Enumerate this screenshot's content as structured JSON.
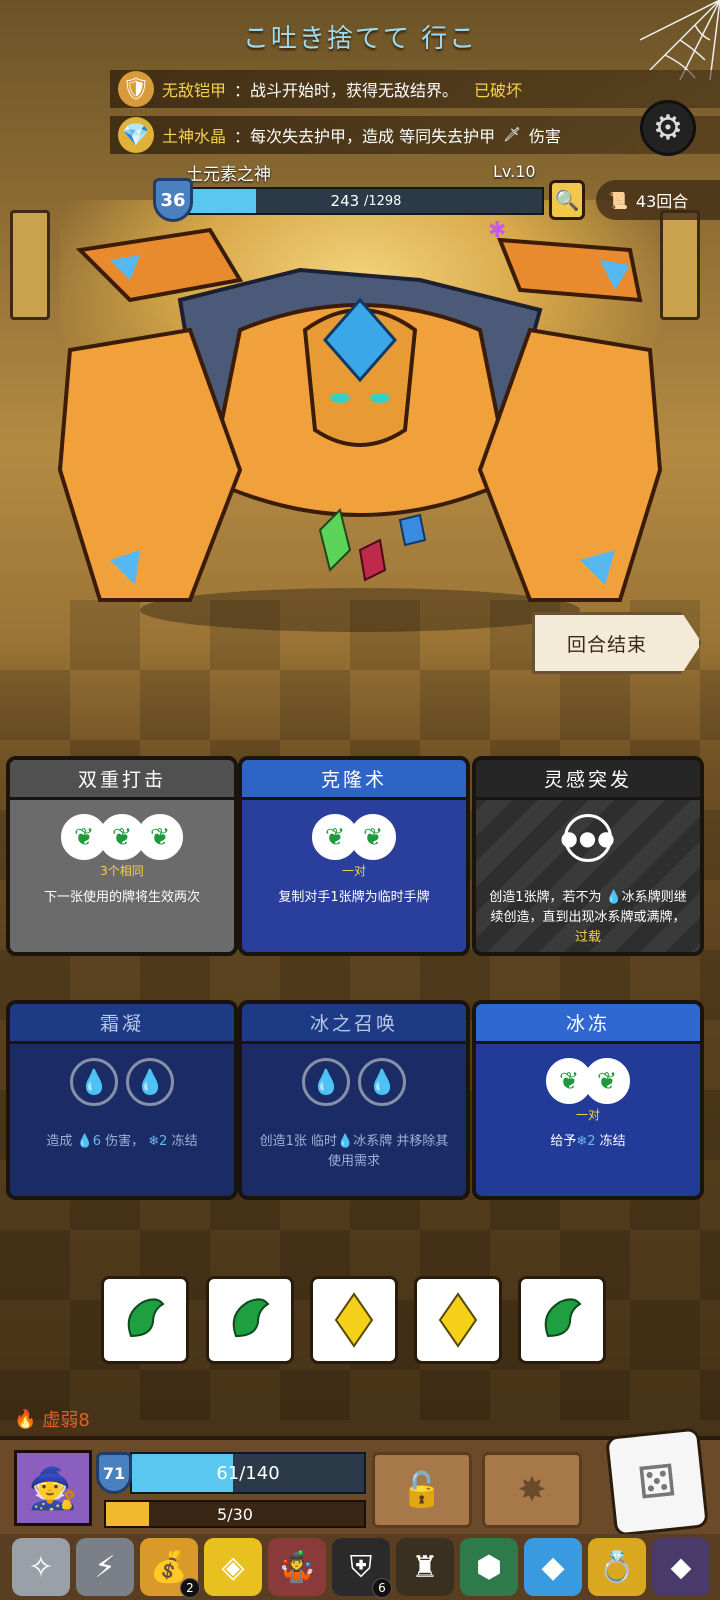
{
  "title_text": "こ吐き捨てて 行こ",
  "relics": [
    {
      "icon": "golden-armor-icon",
      "name": "无敌铠甲",
      "desc": "：战斗开始时，获得无敌结界。",
      "status": "已破坏"
    },
    {
      "icon": "earth-crystal-icon",
      "name": "土神水晶",
      "desc": "：每次失去护甲，造成 等同失去护甲",
      "desc_tail": "伤害"
    }
  ],
  "enemy": {
    "name": "土元素之神",
    "level": "Lv.10",
    "shield": "36",
    "hp_current": "243",
    "hp_max": "/1298",
    "hp_fraction": 0.187
  },
  "turn_counter": "43回合",
  "end_turn_label": "回合结束",
  "cards": [
    {
      "title": "双重打击",
      "slots": 3,
      "req": "3个相同",
      "desc": "下一张使用的牌将生效两次"
    },
    {
      "title": "克隆术",
      "slots": 2,
      "req": "一对",
      "desc": "复制对手1张牌为临时手牌"
    },
    {
      "title": "灵感突发",
      "desc_a": "创造1张牌，若不为 ",
      "desc_b": "冰系牌则继续创造，直到出现冰系牌或满牌，",
      "desc_hl": "过载"
    },
    {
      "title": "霜凝",
      "desc_a": "造成 ",
      "value_a": "6",
      "desc_b": " 伤害， ",
      "value_b": "2",
      "desc_c": " 冻结"
    },
    {
      "title": "冰之召唤",
      "desc": "创造1张 临时",
      "desc_b": "冰系牌 并移除其使用需求"
    },
    {
      "title": "冰冻",
      "slots": 2,
      "req": "一对",
      "desc_a": "给予",
      "value": "2",
      "desc_b": " 冻结"
    }
  ],
  "dice": [
    "leaf",
    "leaf",
    "diamond",
    "diamond",
    "leaf"
  ],
  "weak_status": "虚弱8",
  "player": {
    "shield": "71",
    "hp": "61/140",
    "hp_fraction": 0.436,
    "energy": "5/30",
    "energy_fraction": 0.167
  },
  "tray": [
    {
      "icon": "silver-ornament-icon"
    },
    {
      "icon": "lightning-orb-icon"
    },
    {
      "icon": "gold-sack-icon",
      "badge": "2"
    },
    {
      "icon": "red-gem-frame-icon"
    },
    {
      "icon": "jester-figure-icon"
    },
    {
      "icon": "black-shield-icon",
      "badge": "6"
    },
    {
      "icon": "dark-armor-icon"
    },
    {
      "icon": "turtle-shell-icon"
    },
    {
      "icon": "blue-crystal-icon"
    },
    {
      "icon": "gold-ring-icon"
    },
    {
      "icon": "purple-crystal-icon"
    }
  ]
}
